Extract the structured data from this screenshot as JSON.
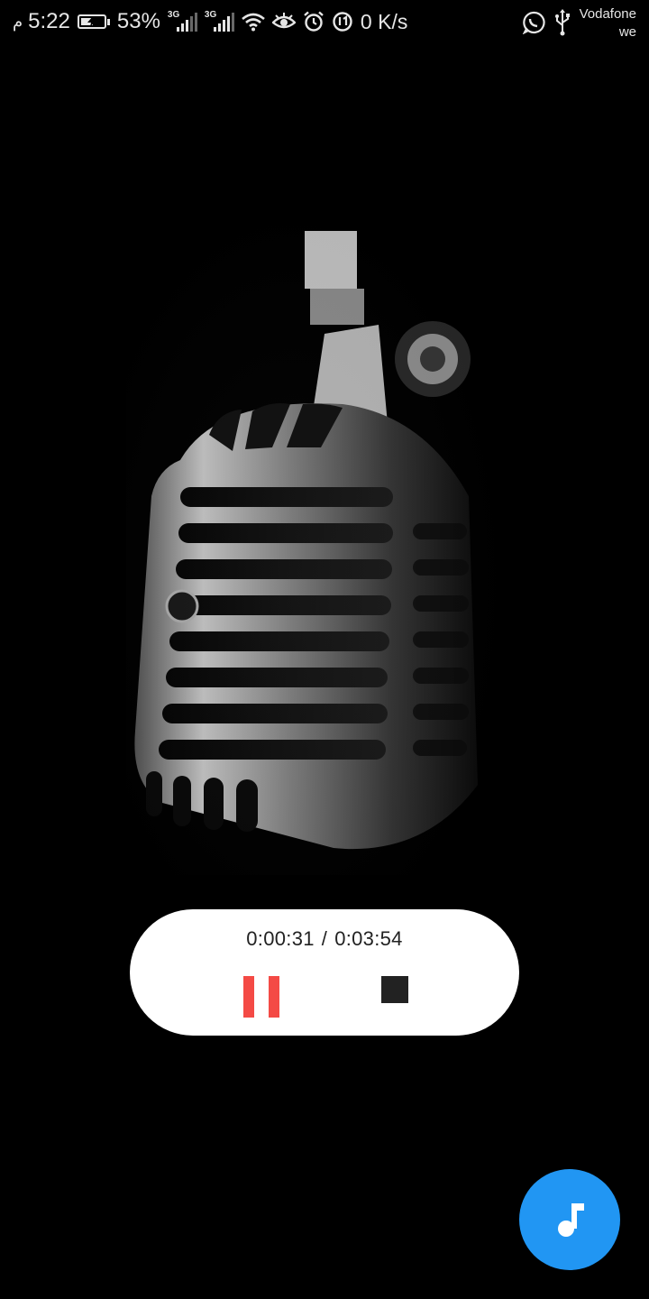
{
  "status_bar": {
    "time": "5:22",
    "ampm": "م",
    "battery_percent": "53%",
    "battery_level": 0.53,
    "network_sim1": "3G",
    "network_sim2": "3G",
    "net_speed": "0 K/s",
    "carrier_line1": "Vodafone",
    "carrier_line2": "we",
    "icons": [
      "charging-battery-icon",
      "signal-icon",
      "signal-icon",
      "wifi-icon",
      "eye-icon",
      "alarm-icon",
      "data-saver-icon",
      "whatsapp-icon",
      "usb-icon"
    ]
  },
  "artwork": {
    "subject": "microphone-icon"
  },
  "player": {
    "elapsed": "0:00:31",
    "separator": "/",
    "duration": "0:03:54",
    "pause_icon": "pause-icon",
    "stop_icon": "stop-icon",
    "colors": {
      "pause": "#f44a45",
      "stop": "#222222",
      "background": "#ffffff"
    }
  },
  "fab": {
    "icon": "music-note-icon",
    "color": "#2196f3"
  }
}
